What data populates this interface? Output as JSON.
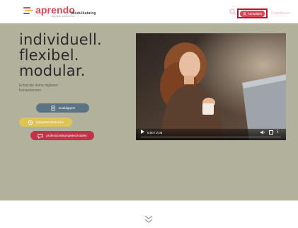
{
  "header": {
    "logo_name": "aprendo",
    "logo_tagline": "digitale kompetenz",
    "nav_label": "Modulkatalog",
    "login_label": "Anmelden",
    "register_label": "Registrieren"
  },
  "hero": {
    "headline_line1": "individuell.",
    "headline_line2": "flexibel.",
    "headline_line3": "modular.",
    "subtext": "Entwickle deine digitalen Kompetenzen",
    "buttons": {
      "modules": "modulgrpen",
      "competence": "kompetenzbereiche",
      "professional": "professionskompetenzstufen"
    }
  },
  "video": {
    "time": "0:00 / 2:06",
    "progress_fraction": 0
  },
  "icons": {
    "search": "search-icon",
    "user": "user-icon",
    "play": "play-icon",
    "volume": "volume-icon",
    "fullscreen": "fullscreen-icon",
    "more": "more-vert-icon",
    "scroll_down": "double-chevron-down-icon"
  },
  "colors": {
    "brand": "#d64a57",
    "hero_bg": "#b2b29c",
    "button_modules": "#5c7384",
    "button_competence": "#dfc35a",
    "button_professional": "#c23249",
    "highlight_box": "#c8102e"
  }
}
